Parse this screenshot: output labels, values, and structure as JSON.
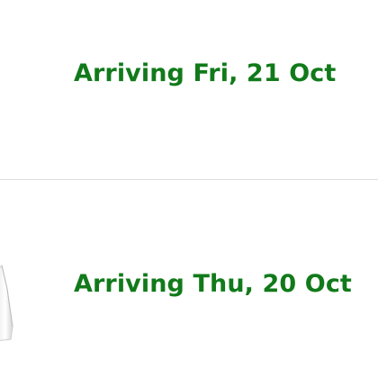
{
  "orders": [
    {
      "status": "Arriving Fri, 21 Oct"
    },
    {
      "status": "Arriving Thu, 20 Oct",
      "thumbnail": "white-product-image"
    }
  ],
  "colors": {
    "status_green": "#117a1a",
    "divider": "#dddddd",
    "background": "#ffffff"
  }
}
